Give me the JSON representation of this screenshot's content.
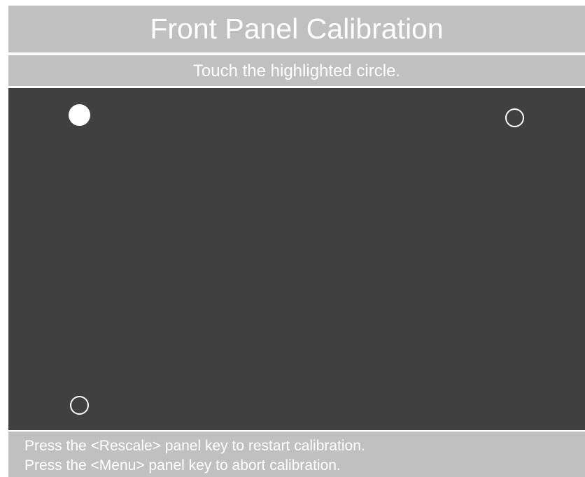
{
  "header": {
    "title": "Front Panel Calibration",
    "instruction": "Touch the highlighted circle."
  },
  "calibration": {
    "targets": [
      {
        "name": "top-left",
        "highlighted": true
      },
      {
        "name": "top-right",
        "highlighted": false
      },
      {
        "name": "bottom-left",
        "highlighted": false
      }
    ]
  },
  "footer": {
    "line1": "Press the <Rescale> panel key to restart calibration.",
    "line2": "Press the <Menu> panel key to abort calibration."
  },
  "colors": {
    "background": "#404040",
    "bars": "#c0c0c0",
    "text": "#ffffff"
  }
}
